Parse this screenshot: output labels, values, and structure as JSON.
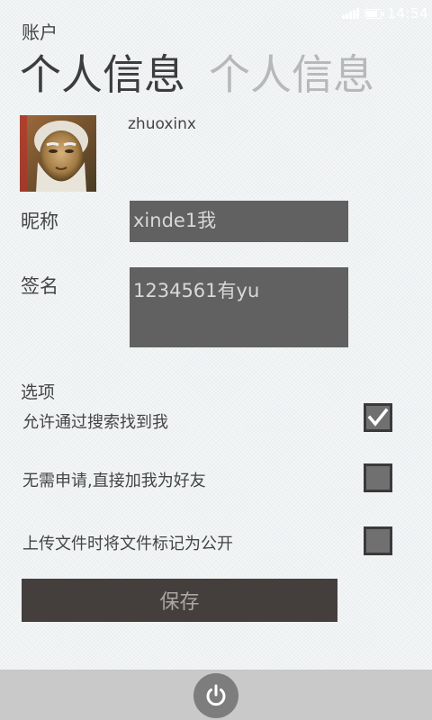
{
  "status_bar": {
    "time": "14:54",
    "signal_icon": "signal-icon",
    "battery_icon": "battery-icon"
  },
  "app_title": "账户",
  "pivot": [
    {
      "label": "个人信息",
      "active": true
    },
    {
      "label": "个人信息",
      "active": false
    }
  ],
  "profile": {
    "avatar_icon": "avatar-photo",
    "username": "zhuoxinx",
    "nickname": {
      "label": "昵称",
      "value": "xinde1我"
    },
    "signature": {
      "label": "签名",
      "value": "1234561有yu"
    }
  },
  "options": {
    "heading": "选项",
    "items": [
      {
        "label": "允许通过搜索找到我",
        "checked": true
      },
      {
        "label": "无需申请,直接加我为好友",
        "checked": false
      },
      {
        "label": "上传文件时将文件标记为公开",
        "checked": false
      }
    ]
  },
  "save_button": {
    "label": "保存"
  },
  "app_bar": {
    "power_icon": "power-icon"
  },
  "colors": {
    "background": "#f4f6f7",
    "input_bg": "#616161",
    "save_button_bg": "#443f3d",
    "app_bar_bg": "#c9c9c9"
  }
}
